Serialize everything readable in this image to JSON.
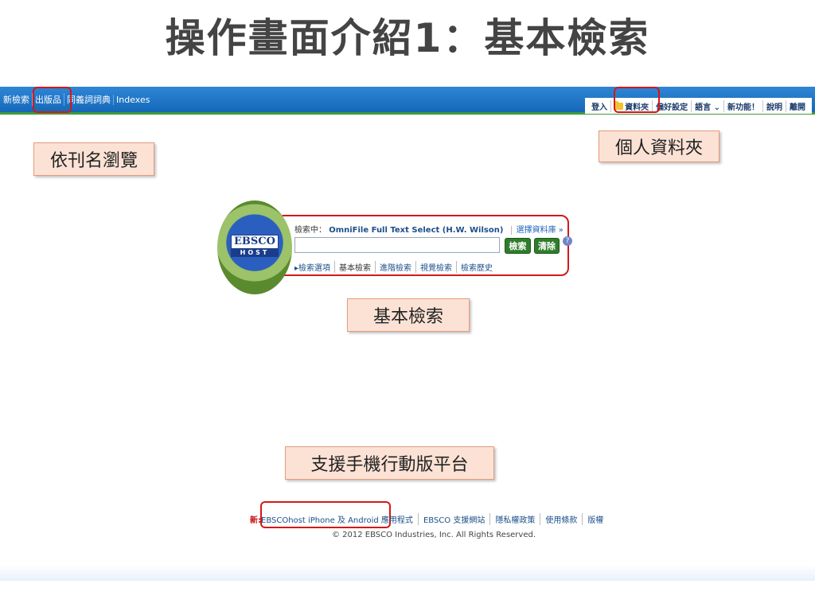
{
  "slide": {
    "title": "操作畫面介紹1：基本檢索"
  },
  "topbar": {
    "left_items": [
      "新檢索",
      "出版品",
      "同義詞詞典",
      "Indexes"
    ],
    "right_items": [
      "登入",
      "資料夾",
      "偏好設定",
      "語言 ⌄",
      "新功能！",
      "說明",
      "離開"
    ]
  },
  "callouts": {
    "publications": "依刊名瀏覽",
    "folder": "個人資料夾",
    "basic_search": "基本檢索",
    "mobile": "支援手機行動版平台"
  },
  "logo": {
    "brand": "EBSCO",
    "sub": "HOST"
  },
  "search": {
    "searching_label": "檢索中：",
    "database": "OmniFile Full Text Select (H.W. Wilson)",
    "choose_db": "選擇資料庫 »",
    "input_value": "",
    "search_button": "檢索",
    "clear_button": "清除",
    "help_icon": "?",
    "links": [
      "▸檢索選項",
      "基本檢索",
      "進階檢索",
      "視覺檢索",
      "檢索歷史"
    ]
  },
  "footer": {
    "new_label": "新:",
    "links": [
      "EBSCOhost iPhone 及 Android 應用程式",
      "EBSCO 支援網站",
      "隱私權政策",
      "使用條款",
      "版權"
    ],
    "copyright": "© 2012 EBSCO Industries, Inc. All Rights Reserved."
  },
  "colors": {
    "topbar": "#1568b8",
    "highlight": "#d41818",
    "button": "#2f7d2c",
    "callout_bg": "#fbe2d5"
  }
}
